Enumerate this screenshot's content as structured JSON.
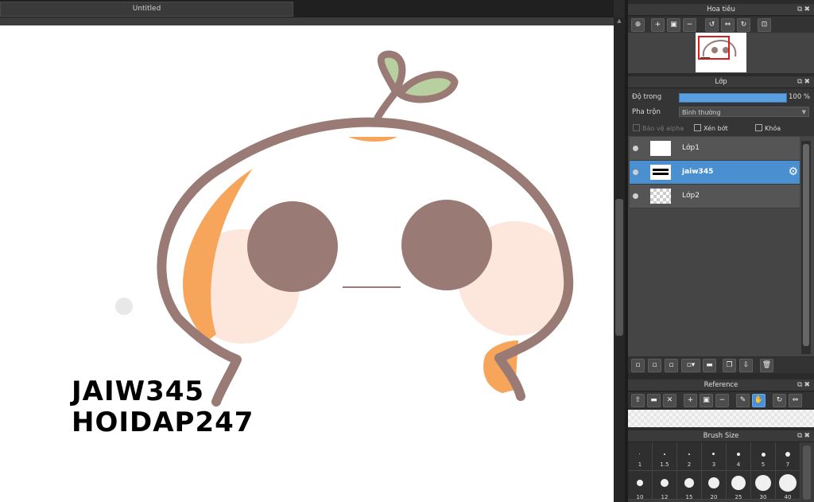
{
  "document": {
    "tab_title": "Untitled"
  },
  "canvas": {
    "watermark_line1": "JAIW345",
    "watermark_line2": "HOIDAP247"
  },
  "navigator": {
    "title": "Hoa tiêu"
  },
  "layers_panel": {
    "title": "Lớp",
    "opacity_label": "Độ trong",
    "opacity_value": "100 %",
    "opacity_percent": 100,
    "blend_label": "Pha trộn",
    "blend_value": "Bình thường",
    "protect_alpha_label": "Bảo vệ alpha",
    "clipping_label": "Xén bớt",
    "lock_label": "Khóa",
    "layers": [
      {
        "name": "Lớp1",
        "selected": false
      },
      {
        "name": "jaiw345",
        "selected": true
      },
      {
        "name": "Lớp2",
        "selected": false
      }
    ]
  },
  "reference_panel": {
    "title": "Reference"
  },
  "brush_panel": {
    "title": "Brush Size",
    "sizes_row1": [
      "1",
      "1.5",
      "2",
      "3",
      "4",
      "5",
      "7"
    ],
    "sizes_row2": [
      "10",
      "12",
      "15",
      "20",
      "25",
      "30",
      "40"
    ]
  },
  "colors": {
    "accent": "#4a8fd0",
    "outline": "#9a7a74",
    "leaf": "#b8d0a0",
    "orange": "#f7a55a",
    "blush": "#fde3d6"
  }
}
